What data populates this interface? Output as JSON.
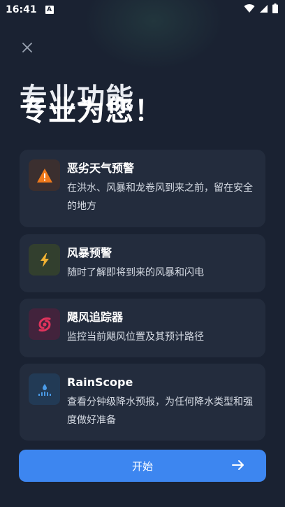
{
  "status_bar": {
    "time": "16:41",
    "badge": "A"
  },
  "headline": {
    "line1": "专业功能",
    "line2": "专业为您！"
  },
  "features": [
    {
      "title": "恶劣天气预警",
      "desc": "在洪水、风暴和龙卷风到来之前，留在安全的地方",
      "icon": "warning-icon",
      "icon_bg": "#3b2f2f",
      "icon_color": "#f07a1c"
    },
    {
      "title": "风暴预警",
      "desc": "随时了解即将到来的风暴和闪电",
      "icon": "lightning-icon",
      "icon_bg": "#323f2e",
      "icon_color": "#f2b233"
    },
    {
      "title": "飓风追踪器",
      "desc": "监控当前飓风位置及其预计路径",
      "icon": "hurricane-icon",
      "icon_bg": "#42233c",
      "icon_color": "#e0335c"
    },
    {
      "title": "RainScope",
      "desc": "查看分钟级降水预报，为任何降水类型和强度做好准备",
      "icon": "rain-radar-icon",
      "icon_bg": "#223a55",
      "icon_color": "#4a9be8"
    }
  ],
  "cta": {
    "label": "开始"
  }
}
